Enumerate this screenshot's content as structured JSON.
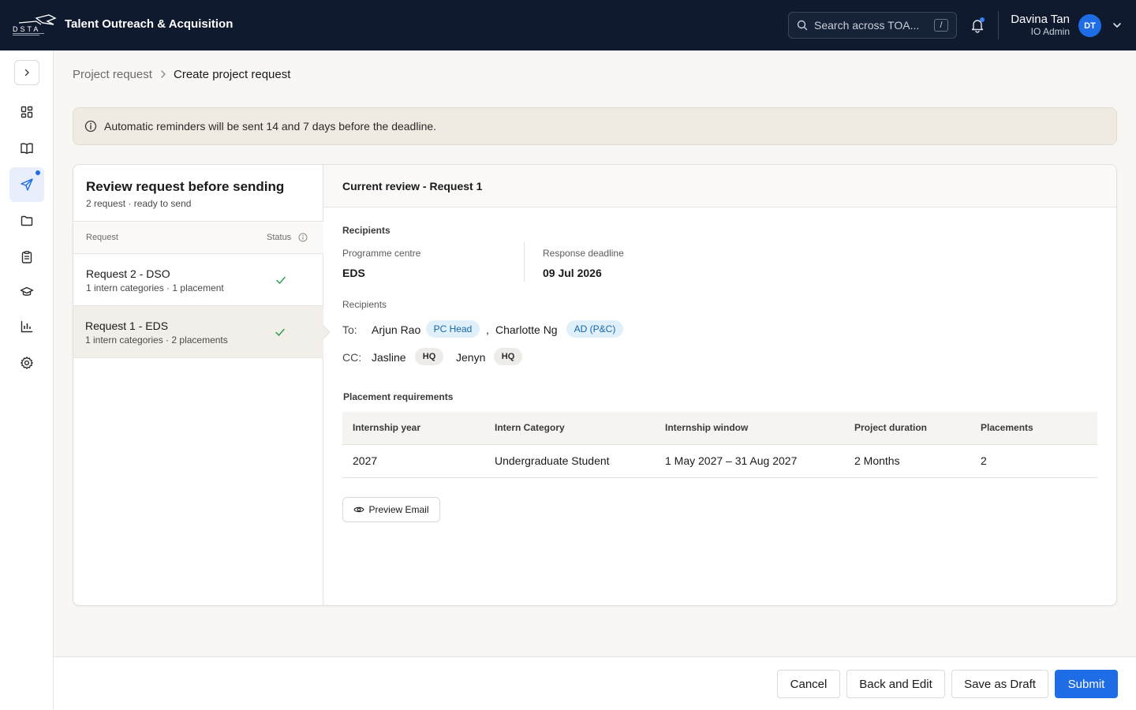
{
  "header": {
    "logo_text": "DSTA",
    "app_title": "Talent Outreach & Acquisition",
    "search_placeholder": "Search across TOA...",
    "search_shortcut": "/",
    "user_name": "Davina Tan",
    "user_role": "IO Admin",
    "user_initials": "DT"
  },
  "sidebar": {
    "items": [
      {
        "icon": "dashboard-icon"
      },
      {
        "icon": "book-icon"
      },
      {
        "icon": "send-icon",
        "active": true
      },
      {
        "icon": "folder-icon"
      },
      {
        "icon": "clipboard-icon"
      },
      {
        "icon": "graduation-cap-icon"
      },
      {
        "icon": "bar-chart-icon"
      },
      {
        "icon": "gear-icon"
      }
    ]
  },
  "breadcrumb": {
    "parent": "Project request",
    "current": "Create project request"
  },
  "banner": {
    "text": "Automatic reminders will be sent 14 and 7 days before the deadline."
  },
  "review": {
    "title": "Review request before sending",
    "subtitle": "2 request · ready to send",
    "col_request": "Request",
    "col_status": "Status",
    "requests": [
      {
        "title": "Request 2 - DSO",
        "meta": "1 intern categories · 1 placement",
        "status": "done"
      },
      {
        "title": "Request 1 - EDS",
        "meta": "1 intern categories · 2 placements",
        "status": "done",
        "selected": true
      }
    ]
  },
  "current": {
    "title": "Current review - Request 1",
    "recipients_section": "Recipients",
    "programme_centre_label": "Programme centre",
    "programme_centre_value": "EDS",
    "deadline_label": "Response deadline",
    "deadline_value": "09 Jul 2026",
    "recipients_label": "Recipients",
    "to_label": "To:",
    "cc_label": "CC:",
    "to": [
      {
        "name": "Arjun Rao",
        "role": "PC Head"
      },
      {
        "name": "Charlotte Ng",
        "role": "AD (P&C)"
      }
    ],
    "cc": [
      {
        "name": "Jasline",
        "role": "HQ"
      },
      {
        "name": "Jenyn",
        "role": "HQ"
      }
    ],
    "placement_section": "Placement requirements",
    "table": {
      "headers": [
        "Internship year",
        "Intern Category",
        "Internship window",
        "Project duration",
        "Placements"
      ],
      "rows": [
        [
          "2027",
          "Undergraduate Student",
          "1 May 2027 – 31 Aug 2027",
          "2 Months",
          "2"
        ]
      ]
    },
    "preview_label": "Preview Email"
  },
  "footer": {
    "cancel": "Cancel",
    "back_edit": "Back and Edit",
    "save_draft": "Save as Draft",
    "submit": "Submit"
  },
  "colors": {
    "topbar": "#0f1a2e",
    "primary": "#1e6ce6",
    "success": "#2e9e4f"
  }
}
